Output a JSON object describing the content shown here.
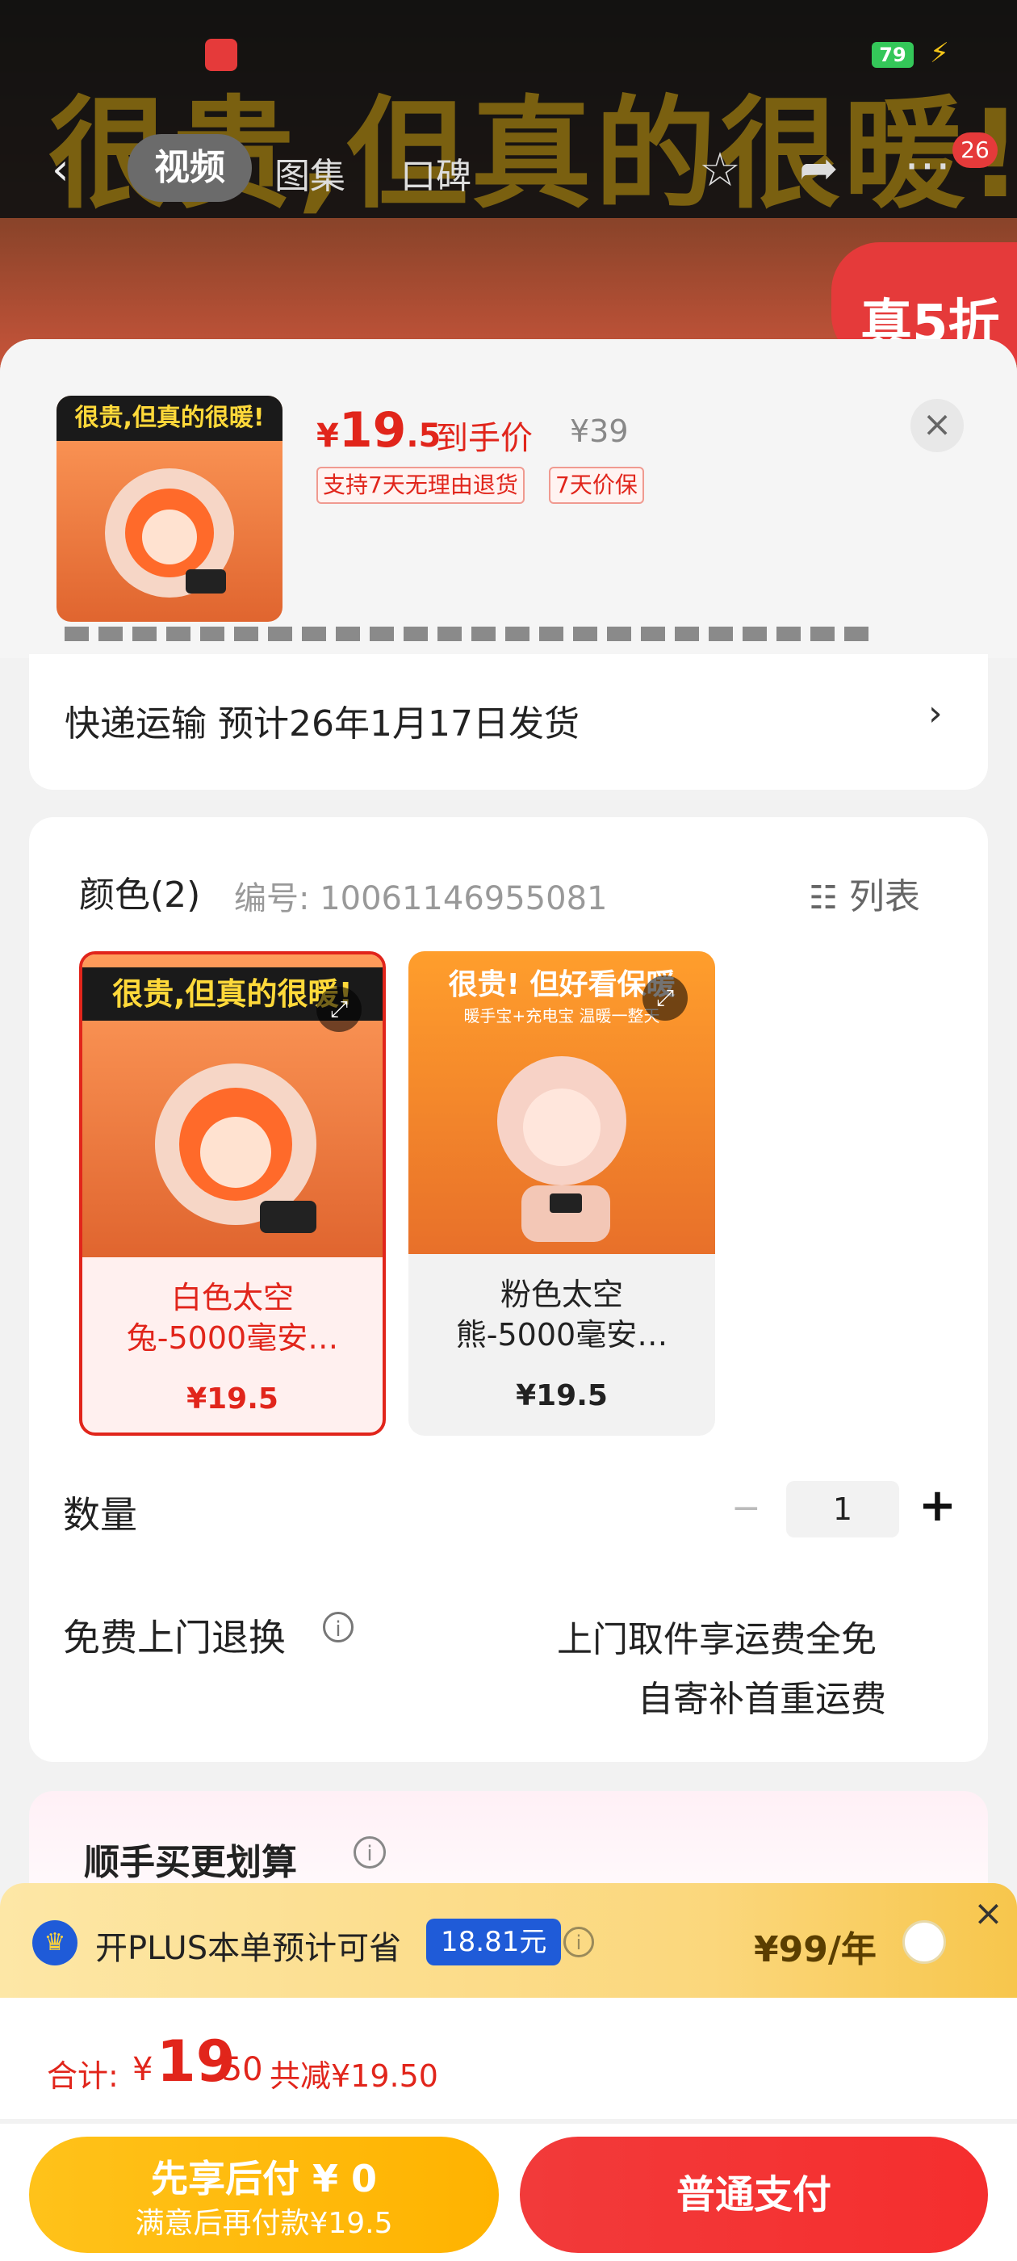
{
  "status_bar": {
    "time": "",
    "battery": "79"
  },
  "hero": {
    "slogan": "很贵,但真的很暖!",
    "badge": "真5折"
  },
  "nav": {
    "tabs": [
      "视频",
      "图集",
      "口碑"
    ],
    "message_count": "26",
    "icons": [
      "back-icon",
      "star-icon",
      "share-icon",
      "more-icon"
    ]
  },
  "product": {
    "thumb_caption": "很贵,但真的很暖!",
    "price_symbol": "¥",
    "price_int": "19",
    "price_dec": ".5",
    "price_label": "到手价",
    "original_price": "¥39",
    "tags": [
      "支持7天无理由退货",
      "7天价保"
    ]
  },
  "shipping": {
    "text": "快递运输 预计26年1月17日发货"
  },
  "color_section": {
    "title": "颜色(2)",
    "code": "编号: 10061146955081",
    "list_label": "列表",
    "options": [
      {
        "caption": "很贵,但真的很暖!",
        "name_line1": "白色太空",
        "name_line2": "兔-5000毫安…",
        "price": "¥19.5",
        "selected": true
      },
      {
        "caption": "很贵! 但好看保暖",
        "sub_caption": "暖手宝+充电宝 温暖一整天",
        "name_line1": "粉色太空",
        "name_line2": "熊-5000毫安…",
        "price": "¥19.5",
        "selected": false
      }
    ]
  },
  "quantity": {
    "label": "数量",
    "value": "1",
    "minus": "−",
    "plus": "+"
  },
  "return_service": {
    "label": "免费上门退换",
    "line1": "上门取件享运费全免",
    "line2": "自寄补首重运费"
  },
  "addon": {
    "title": "顺手买更划算"
  },
  "plus": {
    "text": "开PLUS本单预计可省",
    "save": "18.81元",
    "price": "¥99/年"
  },
  "total": {
    "label": "合计:",
    "yen": "¥",
    "int": "19",
    "dec": ".50",
    "discount": "共减¥19.50"
  },
  "buttons": {
    "later_l1": "先享后付 ¥ 0",
    "later_l2": "满意后再付款¥19.5",
    "pay": "普通支付"
  },
  "colors": {
    "accent": "#e1251b",
    "plus_blue": "#1f5bd8",
    "later_yellow": "#ffb300",
    "pay_red": "#f23a3a"
  }
}
